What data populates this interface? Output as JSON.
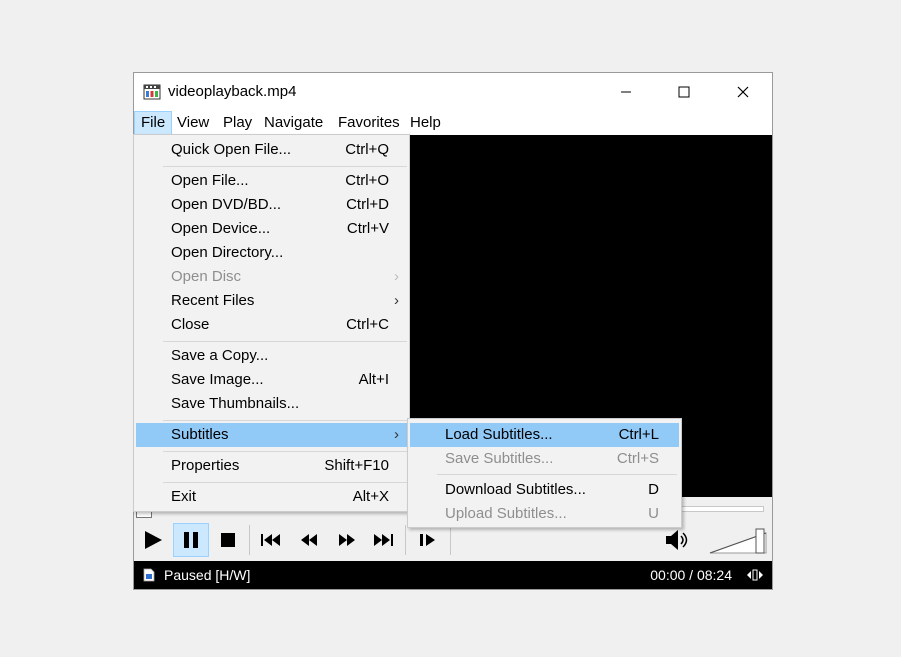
{
  "window": {
    "title": "videoplayback.mp4"
  },
  "menubar": {
    "items": [
      "File",
      "View",
      "Play",
      "Navigate",
      "Favorites",
      "Help"
    ]
  },
  "file_menu": {
    "items": [
      {
        "label": "Quick Open File...",
        "shortcut": "Ctrl+Q"
      },
      {
        "label": "Open File...",
        "shortcut": "Ctrl+O"
      },
      {
        "label": "Open DVD/BD...",
        "shortcut": "Ctrl+D"
      },
      {
        "label": "Open Device...",
        "shortcut": "Ctrl+V"
      },
      {
        "label": "Open Directory...",
        "shortcut": ""
      },
      {
        "label": "Open Disc",
        "shortcut": "",
        "disabled": true
      },
      {
        "label": "Recent Files",
        "shortcut": ""
      },
      {
        "label": "Close",
        "shortcut": "Ctrl+C"
      },
      {
        "label": "Save a Copy...",
        "shortcut": ""
      },
      {
        "label": "Save Image...",
        "shortcut": "Alt+I"
      },
      {
        "label": "Save Thumbnails...",
        "shortcut": ""
      },
      {
        "label": "Subtitles",
        "shortcut": "",
        "highlighted": true
      },
      {
        "label": "Properties",
        "shortcut": "Shift+F10"
      },
      {
        "label": "Exit",
        "shortcut": "Alt+X"
      }
    ]
  },
  "subtitles_menu": {
    "items": [
      {
        "label": "Load Subtitles...",
        "shortcut": "Ctrl+L",
        "highlighted": true
      },
      {
        "label": "Save Subtitles...",
        "shortcut": "Ctrl+S",
        "disabled": true
      },
      {
        "label": "Download Subtitles...",
        "shortcut": "D"
      },
      {
        "label": "Upload Subtitles...",
        "shortcut": "U",
        "disabled": true
      }
    ]
  },
  "controls": {
    "icons": [
      "play-icon",
      "pause-icon",
      "stop-icon",
      "skip-previous-icon",
      "rewind-icon",
      "fast-forward-icon",
      "skip-next-icon",
      "frame-step-icon",
      "volume-icon"
    ],
    "pause_pressed": true,
    "volume_level": 0.9
  },
  "status": {
    "text": "Paused [H/W]",
    "time": "00:00 / 08:24"
  },
  "colors": {
    "highlight": "#91c9f7",
    "active_menu": "#cce8ff",
    "video_bg": "#000000"
  }
}
